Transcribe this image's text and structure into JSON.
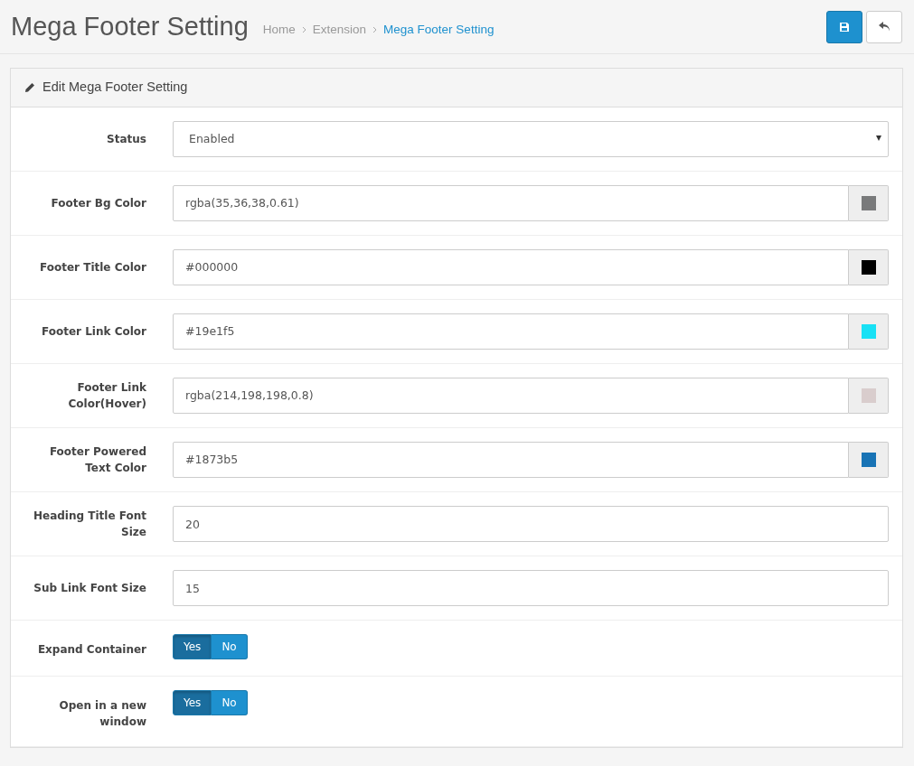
{
  "page_title": "Mega Footer Setting",
  "breadcrumb": [
    {
      "label": "Home",
      "selected": false
    },
    {
      "label": "Extension",
      "selected": false
    },
    {
      "label": "Mega Footer Setting",
      "selected": true
    }
  ],
  "panel_title": "Edit Mega Footer Setting",
  "fields": [
    {
      "kind": "select",
      "label": "Status",
      "value": "Enabled"
    },
    {
      "kind": "color",
      "label": "Footer Bg Color",
      "value": "rgba(35,36,38,0.61)",
      "color": "#797a7b"
    },
    {
      "kind": "color",
      "label": "Footer Title Color",
      "value": "#000000",
      "color": "#000000"
    },
    {
      "kind": "color",
      "label": "Footer Link Color",
      "value": "#19e1f5",
      "color": "#19e1f5"
    },
    {
      "kind": "color",
      "label": "Footer Link Color(Hover)",
      "value": "rgba(214,198,198,0.8)",
      "color": "#d9cdcd"
    },
    {
      "kind": "color",
      "label": "Footer Powered Text Color",
      "value": "#1873b5",
      "color": "#1873b5"
    },
    {
      "kind": "text",
      "label": "Heading Title Font Size",
      "value": "20"
    },
    {
      "kind": "text",
      "label": "Sub Link Font Size",
      "value": "15"
    },
    {
      "kind": "toggle",
      "label": "Expand Container",
      "options": [
        {
          "label": "Yes",
          "selected": true
        },
        {
          "label": "No",
          "selected": false
        }
      ]
    },
    {
      "kind": "toggle",
      "label": "Open in a new window",
      "options": [
        {
          "label": "Yes",
          "selected": true
        },
        {
          "label": "No",
          "selected": false
        }
      ]
    }
  ]
}
